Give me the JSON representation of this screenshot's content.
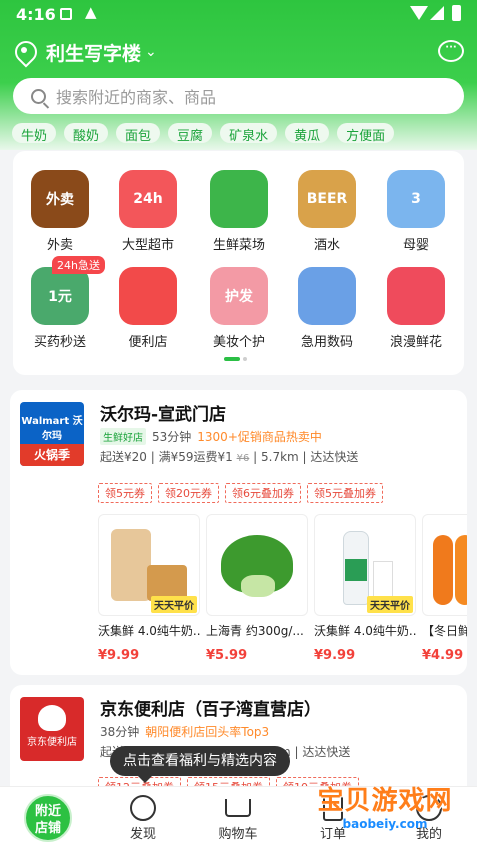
{
  "status": {
    "time": "4:16"
  },
  "header": {
    "location": "利生写字楼",
    "chevron": "⌄"
  },
  "search": {
    "placeholder": "搜索附近的商家、商品"
  },
  "tags": [
    "牛奶",
    "酸奶",
    "面包",
    "豆腐",
    "矿泉水",
    "黄瓜",
    "方便面"
  ],
  "categories": [
    {
      "label": "外卖",
      "icon": "takeout-icon",
      "color": "#8a4a1a",
      "text": "外卖"
    },
    {
      "label": "大型超市",
      "icon": "supermarket-icon",
      "color": "#f3565a",
      "text": "24h"
    },
    {
      "label": "生鲜菜场",
      "icon": "broccoli-icon",
      "color": "#3db54a",
      "text": ""
    },
    {
      "label": "酒水",
      "icon": "beer-icon",
      "color": "#d9a24a",
      "text": "BEER"
    },
    {
      "label": "母婴",
      "icon": "milk-powder-icon",
      "color": "#7bb5ee",
      "text": "3"
    },
    {
      "label": "买药秒送",
      "icon": "medicine-icon",
      "color": "#4aa96c",
      "text": "1元"
    },
    {
      "label": "便利店",
      "icon": "basket-icon",
      "color": "#f24a4a",
      "text": ""
    },
    {
      "label": "美妆个护",
      "icon": "cosmetics-icon",
      "color": "#f39aa5",
      "text": "护发"
    },
    {
      "label": "急用数码",
      "icon": "phone-icon",
      "color": "#6aa0e6",
      "text": ""
    },
    {
      "label": "浪漫鲜花",
      "icon": "rose-icon",
      "color": "#ef4b5c",
      "text": ""
    }
  ],
  "medicine_badge": "24h急送",
  "stores": [
    {
      "name": "沃尔玛-宣武门店",
      "logo_text": "Walmart 沃尔玛",
      "logo_sub": "火锅季",
      "tag": "生鲜好店",
      "time": "53分钟",
      "promo": "1300+促销商品热卖中",
      "fees": "起送¥20 | 满¥59运费¥1",
      "old_fee": "¥6",
      "dist": "| 5.7km | 达达快送",
      "coupons": [
        "领5元券",
        "领20元券",
        "领6元叠加券",
        "领5元叠加券"
      ],
      "products": [
        {
          "title": "沃集鲜 4.0纯牛奶...",
          "price": "¥9.99",
          "flag": "天天平价",
          "icon": "bread-milk-icon"
        },
        {
          "title": "上海青 约300g/...",
          "price": "¥5.99",
          "flag": "",
          "icon": "bok-choy-icon"
        },
        {
          "title": "沃集鲜 4.0纯牛奶...",
          "price": "¥9.99",
          "flag": "天天平价",
          "icon": "milk-bottle-icon"
        },
        {
          "title": "【冬日鲜",
          "price": "¥4.99",
          "flag": "",
          "icon": "carrot-icon"
        }
      ]
    },
    {
      "name": "京东便利店（百子湾直营店）",
      "logo_text": "京东便利店",
      "tag": "",
      "time": "38分钟",
      "promo": "朝阳便利店回头率Top3",
      "fees": "起送",
      "dist": "km | 达达快送",
      "coupons": [
        "领12元叠加券",
        "领15元叠加券",
        "领10元叠加券"
      ]
    }
  ],
  "tooltip": "点击查看福利与精选内容",
  "tabs": {
    "home": "附近店铺",
    "discover": "发现",
    "cart": "购物车",
    "orders": "订单",
    "me": "我的"
  },
  "watermark": {
    "title": "宝贝游戏网",
    "url": "baobeiy.com"
  }
}
